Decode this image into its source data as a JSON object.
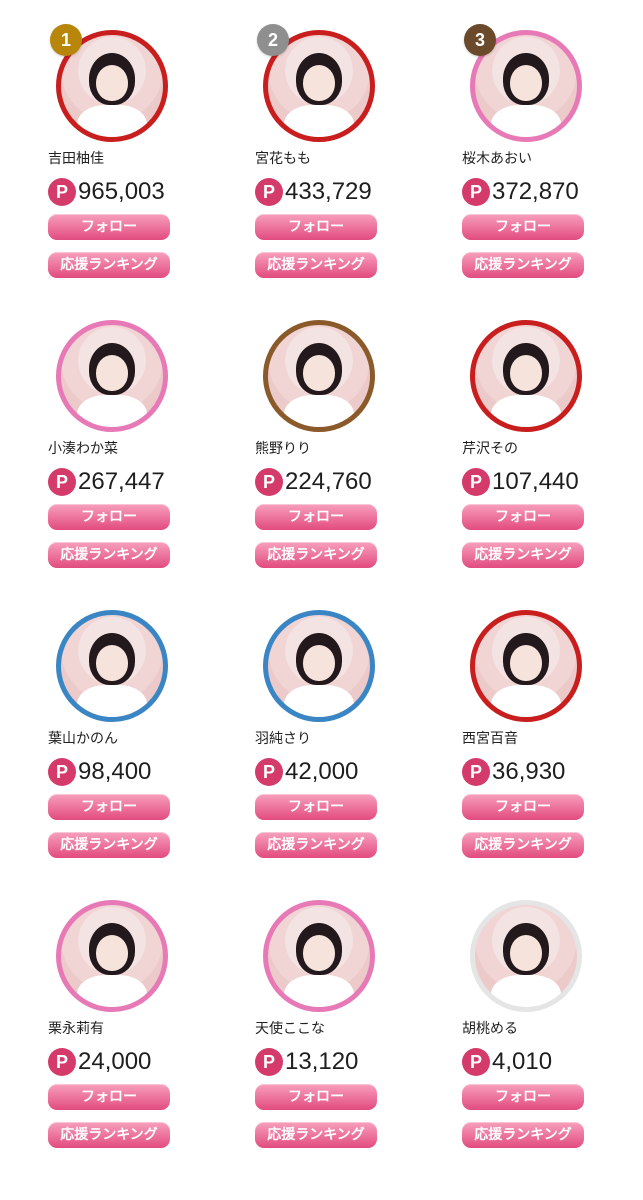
{
  "colors": {
    "accent": "#e24b7f",
    "badge_gold": "#b8860b",
    "badge_silver": "#8f8f8f",
    "badge_bronze": "#6b4a2b",
    "ring_red": "#c81e1e",
    "ring_pink": "#e77ab6",
    "ring_brown": "#8b5a2b",
    "ring_blue": "#3a86c4",
    "ring_white": "#e5e5e5"
  },
  "buttons": {
    "follow": "フォロー",
    "support_ranking": "応援ランキング"
  },
  "point_symbol": "P",
  "items": [
    {
      "rank": "1",
      "name": "吉田柚佳",
      "points": "965,003",
      "ring": "red",
      "badge": "gold"
    },
    {
      "rank": "2",
      "name": "宮花もも",
      "points": "433,729",
      "ring": "red",
      "badge": "silver"
    },
    {
      "rank": "3",
      "name": "桜木あおい",
      "points": "372,870",
      "ring": "pink",
      "badge": "bronze"
    },
    {
      "rank": "",
      "name": "小湊わか菜",
      "points": "267,447",
      "ring": "pink",
      "badge": ""
    },
    {
      "rank": "",
      "name": "熊野りり",
      "points": "224,760",
      "ring": "brown",
      "badge": ""
    },
    {
      "rank": "",
      "name": "芹沢その",
      "points": "107,440",
      "ring": "red",
      "badge": ""
    },
    {
      "rank": "",
      "name": "葉山かのん",
      "points": "98,400",
      "ring": "blue",
      "badge": ""
    },
    {
      "rank": "",
      "name": "羽純さり",
      "points": "42,000",
      "ring": "blue",
      "badge": ""
    },
    {
      "rank": "",
      "name": "西宮百音",
      "points": "36,930",
      "ring": "red",
      "badge": ""
    },
    {
      "rank": "",
      "name": "栗永莉有",
      "points": "24,000",
      "ring": "pink",
      "badge": ""
    },
    {
      "rank": "",
      "name": "天使ここな",
      "points": "13,120",
      "ring": "pink",
      "badge": ""
    },
    {
      "rank": "",
      "name": "胡桃める",
      "points": "4,010",
      "ring": "white",
      "badge": ""
    }
  ]
}
